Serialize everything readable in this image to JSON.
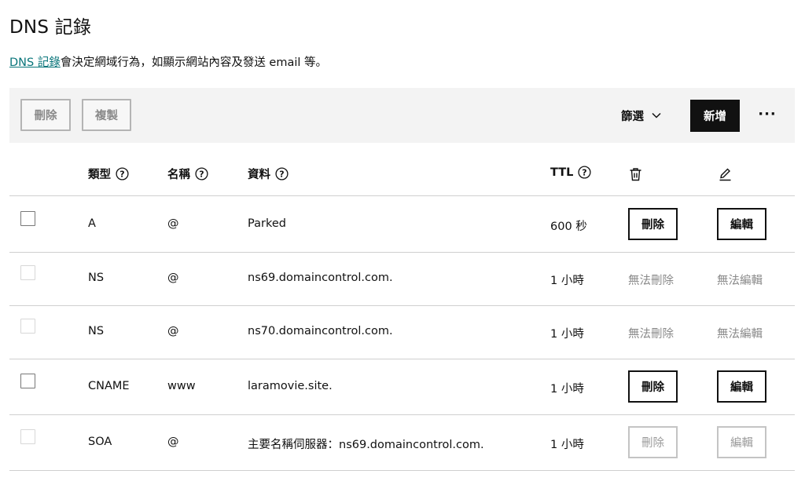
{
  "page": {
    "title": "DNS 記錄",
    "intro_link": "DNS 記錄",
    "intro_text": "會決定網域行為，如顯示網站內容及發送 email 等。"
  },
  "toolbar": {
    "delete_label": "刪除",
    "copy_label": "複製",
    "filter_label": "篩選",
    "add_label": "新增",
    "more_label": "···"
  },
  "table": {
    "headers": {
      "type": "類型",
      "name": "名稱",
      "data": "資料",
      "ttl": "TTL"
    },
    "rows": [
      {
        "type": "A",
        "name": "@",
        "data": "Parked",
        "ttl": "600 秒",
        "delete": "刪除",
        "edit": "編輯",
        "editable": true,
        "selectable": true
      },
      {
        "type": "NS",
        "name": "@",
        "data": "ns69.domaincontrol.com.",
        "ttl": "1 小時",
        "delete": "無法刪除",
        "edit": "無法編輯",
        "editable": false,
        "selectable": false
      },
      {
        "type": "NS",
        "name": "@",
        "data": "ns70.domaincontrol.com.",
        "ttl": "1 小時",
        "delete": "無法刪除",
        "edit": "無法編輯",
        "editable": false,
        "selectable": false
      },
      {
        "type": "CNAME",
        "name": "www",
        "data": "laramovie.site.",
        "ttl": "1 小時",
        "delete": "刪除",
        "edit": "編輯",
        "editable": true,
        "selectable": true
      },
      {
        "type": "SOA",
        "name": "@",
        "data": "主要名稱伺服器：ns69.domaincontrol.com.",
        "ttl": "1 小時",
        "delete": "刪除",
        "edit": "編輯",
        "editable": false,
        "selectable": false
      }
    ]
  },
  "colors": {
    "link": "#09757a",
    "primary_button": "#111111",
    "toolbar_bg": "#f3f3f3",
    "muted_text": "#8a8a8a"
  }
}
